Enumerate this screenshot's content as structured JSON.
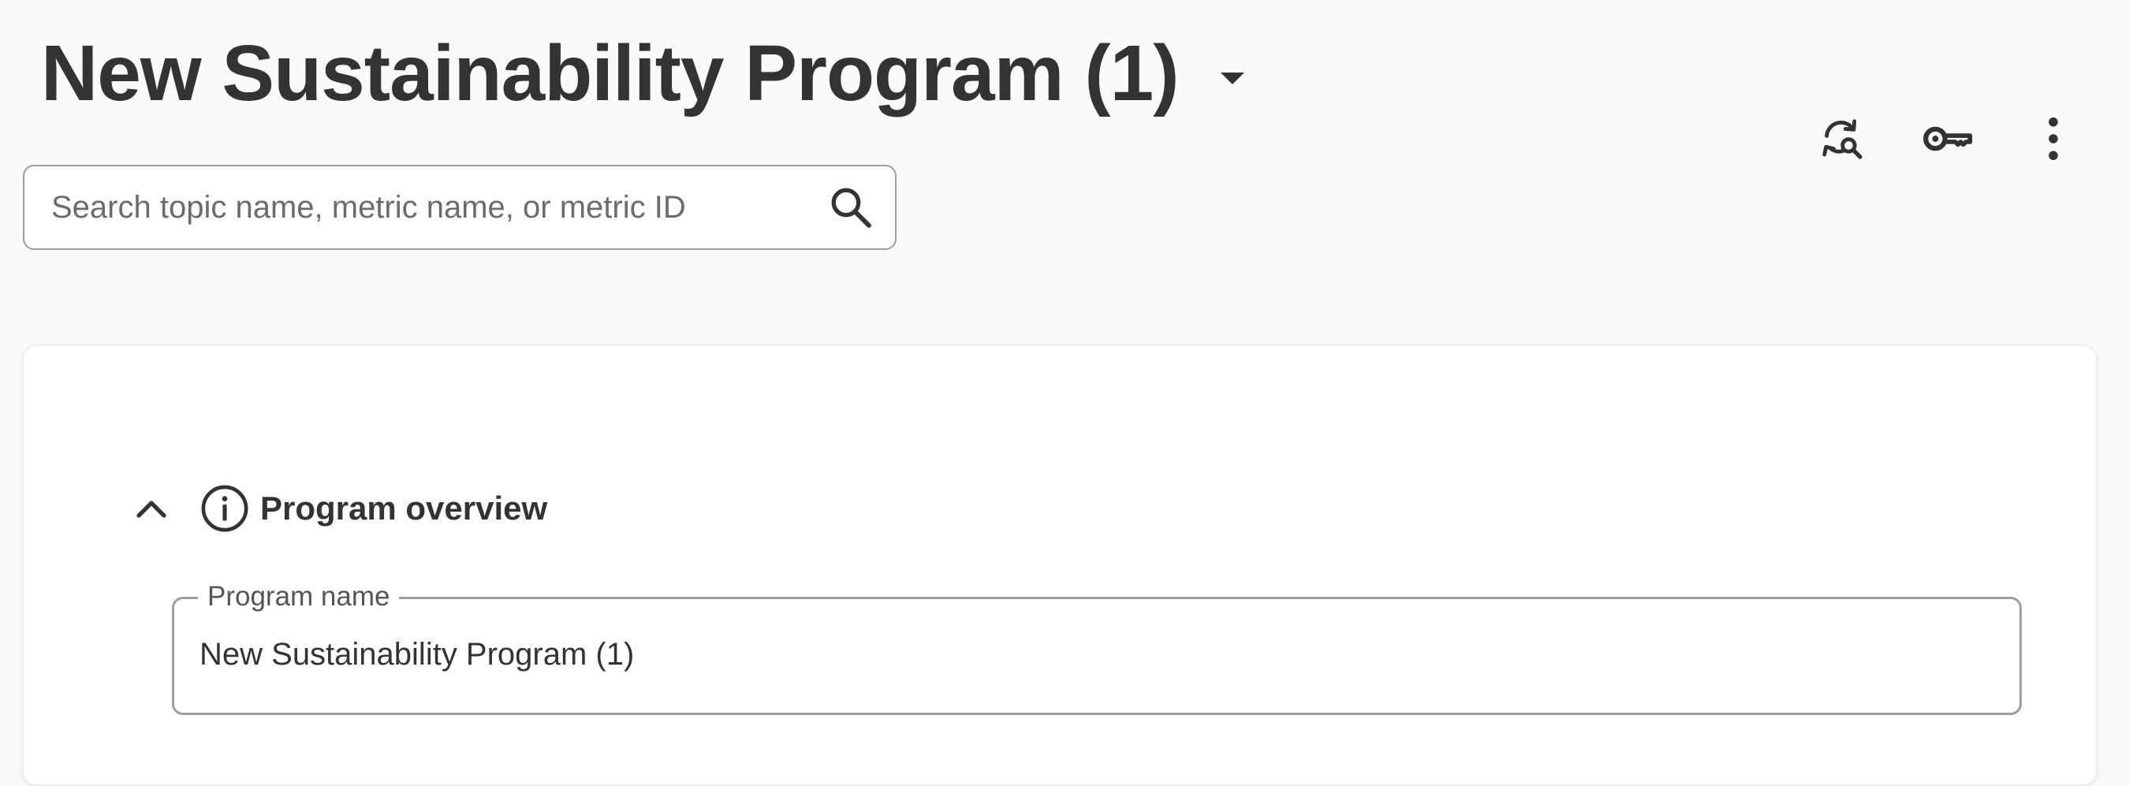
{
  "header": {
    "title": "New Sustainability Program (1)"
  },
  "search": {
    "placeholder": "Search topic name, metric name, or metric ID",
    "value": ""
  },
  "toolbar": {
    "icons": [
      "sync-search-icon",
      "key-icon",
      "more-vertical-icon"
    ]
  },
  "overview": {
    "section_title": "Program overview",
    "program_name_label": "Program name",
    "program_name_value": "New Sustainability Program (1)"
  }
}
